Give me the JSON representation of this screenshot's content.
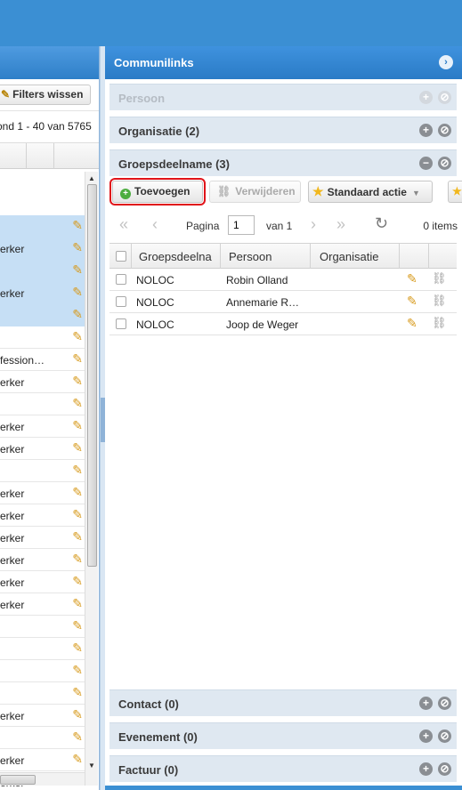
{
  "left": {
    "filters_label": "Filters wissen",
    "range_text": "ond 1 - 40 van 5765",
    "rows": [
      {
        "text": "erker",
        "selected": true,
        "tall": true
      },
      {
        "text": "erker",
        "selected": true,
        "tall": true
      },
      {
        "text": "",
        "selected": true
      },
      {
        "text": ""
      },
      {
        "text": "fession…"
      },
      {
        "text": "erker"
      },
      {
        "text": ""
      },
      {
        "text": "erker"
      },
      {
        "text": "erker"
      },
      {
        "text": ""
      },
      {
        "text": "erker"
      },
      {
        "text": "erker"
      },
      {
        "text": "erker"
      },
      {
        "text": "erker"
      },
      {
        "text": "erker"
      },
      {
        "text": "erker"
      },
      {
        "text": ""
      },
      {
        "text": ""
      },
      {
        "text": ""
      },
      {
        "text": ""
      },
      {
        "text": "erker"
      },
      {
        "text": ""
      },
      {
        "text": "erker"
      },
      {
        "text": "erker"
      },
      {
        "text": "erker"
      }
    ]
  },
  "right": {
    "title": "Communilinks",
    "sections": {
      "persoon": "Persoon",
      "organisatie": "Organisatie (2)",
      "groepsdeelname": "Groepsdeelname (3)",
      "contact": "Contact (0)",
      "evenement": "Evenement (0)",
      "factuur": "Factuur (0)"
    },
    "toolbar": {
      "add": "Toevoegen",
      "delete": "Verwijderen",
      "standard_action": "Standaard actie"
    },
    "pager": {
      "page_label": "Pagina",
      "page_value": "1",
      "of_label": "van 1",
      "items_label": "0 items"
    },
    "grid": {
      "headers": [
        "Groepsdeelna",
        "Persoon",
        "Organisatie"
      ],
      "rows": [
        {
          "group": "NOLOC",
          "person": "Robin Olland",
          "org": ""
        },
        {
          "group": "NOLOC",
          "person": "Annemarie R…",
          "org": ""
        },
        {
          "group": "NOLOC",
          "person": "Joop de Weger",
          "org": ""
        }
      ]
    }
  },
  "icons": {
    "pencil": "pencil-icon",
    "unlink": "unlink-icon",
    "plus": "plus-circle-icon",
    "minus": "minus-circle-icon",
    "block": "block-circle-icon"
  }
}
